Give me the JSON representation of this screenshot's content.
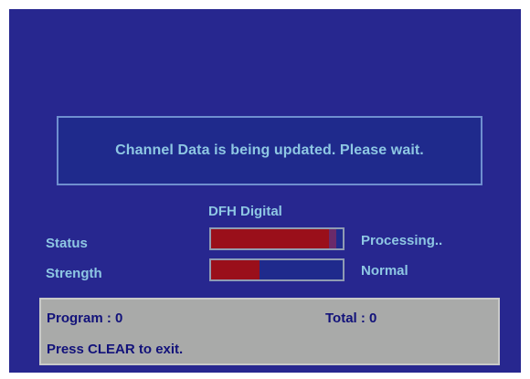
{
  "message": {
    "text": "Channel Data is being updated.  Please wait."
  },
  "provider": {
    "name": "DFH Digital"
  },
  "status": {
    "label": "Status",
    "value_text": "Processing..",
    "level_percent": 95
  },
  "strength": {
    "label": "Strength",
    "value_text": "Normal",
    "level_percent": 37
  },
  "info_panel": {
    "program_text": "Program : 0",
    "total_text": "Total : 0",
    "exit_hint": "Press CLEAR to exit."
  },
  "colors": {
    "screen_background": "#27278f",
    "text_light_blue": "#8ec7e3",
    "bar_fill_red": "#9a0f1a",
    "panel_grey": "#a9aaa9",
    "panel_text_navy": "#12127a"
  }
}
